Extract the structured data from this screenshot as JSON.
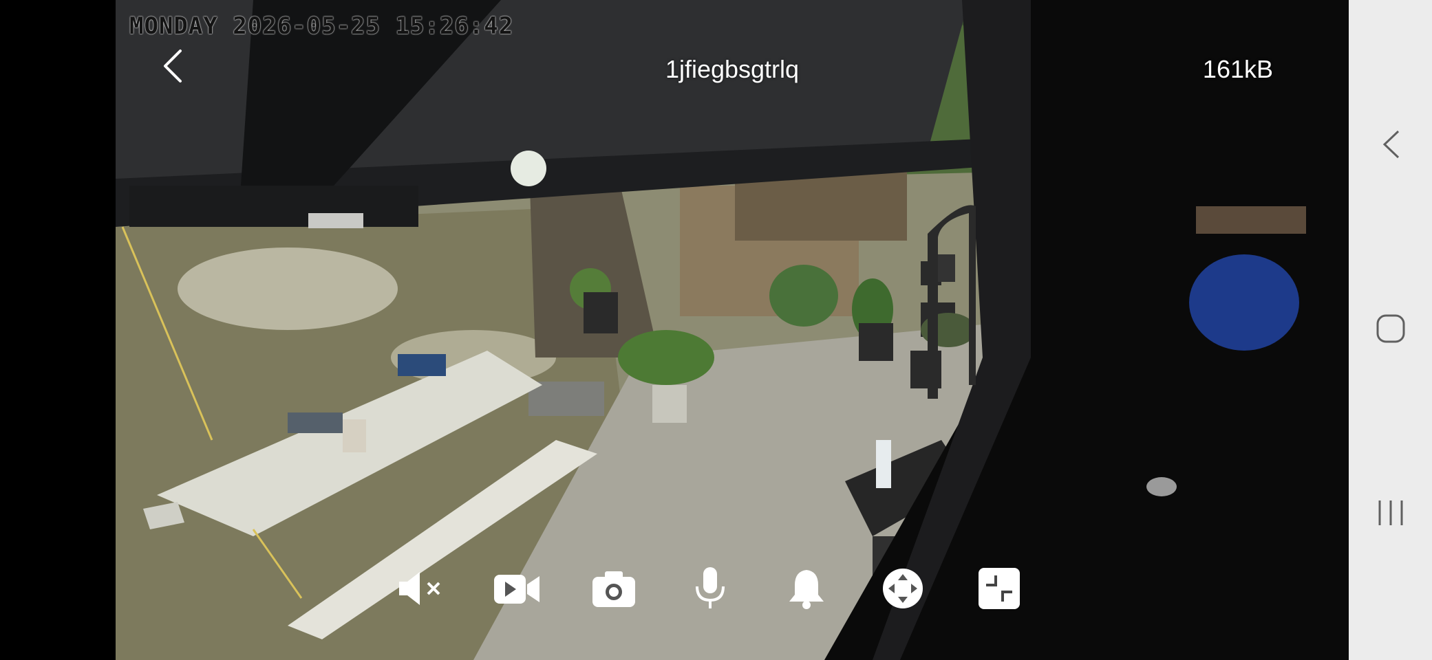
{
  "camera_view": {
    "osd_timestamp": "MONDAY 2026-05-25 15:26:42"
  },
  "header": {
    "camera_name": "1jfiegbsgtrlq",
    "bitrate": "161kB",
    "back_icon": "chevron-left-icon"
  },
  "controls": [
    {
      "name": "mute",
      "icon": "speaker-muted-icon"
    },
    {
      "name": "record",
      "icon": "video-camera-icon"
    },
    {
      "name": "snapshot",
      "icon": "camera-icon"
    },
    {
      "name": "talk",
      "icon": "microphone-icon"
    },
    {
      "name": "alarm",
      "icon": "bell-icon"
    },
    {
      "name": "ptz",
      "icon": "ptz-direction-icon"
    },
    {
      "name": "exit-fullscreen",
      "icon": "collapse-icon"
    }
  ],
  "system_nav": {
    "background": "#ececec",
    "buttons": [
      "back-icon",
      "home-icon",
      "recents-icon"
    ]
  },
  "colors": {
    "overlay_text": "#ffffff",
    "osd_text": "#141414"
  }
}
